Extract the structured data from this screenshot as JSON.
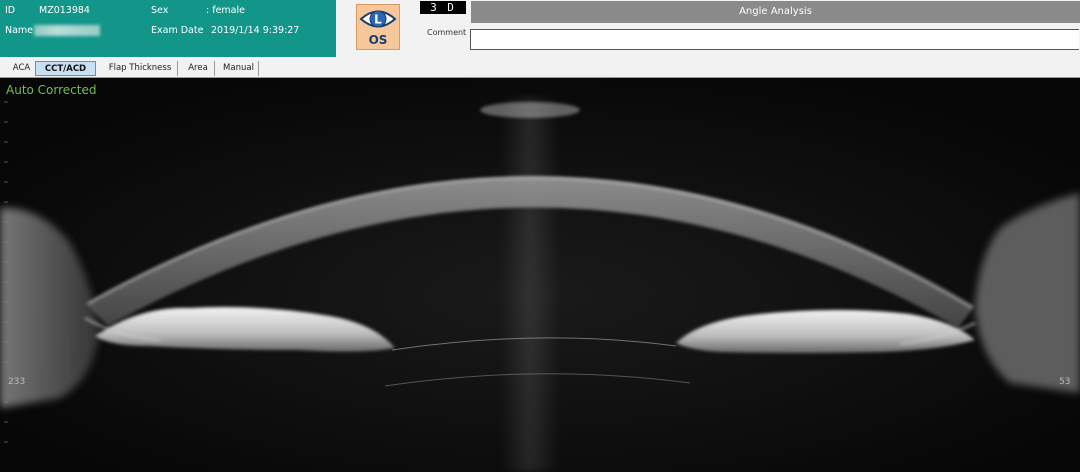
{
  "patient": {
    "id_label": "ID",
    "id_value": "MZ013984",
    "name_label": "Name",
    "sex_label": "Sex",
    "sex_value": ":  female",
    "exam_date_label": "Exam Date",
    "exam_date_value": "2019/1/14  9:39:27"
  },
  "eye_badge": {
    "letter": "L",
    "side": "OS",
    "icon": "eye-laterality-icon"
  },
  "mode": {
    "label": "3 D"
  },
  "analysis": {
    "title": "Angle Analysis",
    "comment_label": "Comment",
    "comment_value": ""
  },
  "tabs": [
    {
      "label": "ACA",
      "active": false
    },
    {
      "label": "CCT/ACD",
      "active": true
    },
    {
      "label": "Flap Thickness",
      "active": false
    },
    {
      "label": "Area",
      "active": false
    },
    {
      "label": "Manual",
      "active": false
    }
  ],
  "viewer": {
    "status_text": "Auto Corrected",
    "left_marker": "233",
    "right_marker": "53"
  },
  "colors": {
    "patient_panel": "#12968a",
    "analysis_header": "#8a8a8a",
    "status_text": "#6fbf4e",
    "active_tab": "#c9dff2",
    "eye_badge": "#f5c79a"
  }
}
